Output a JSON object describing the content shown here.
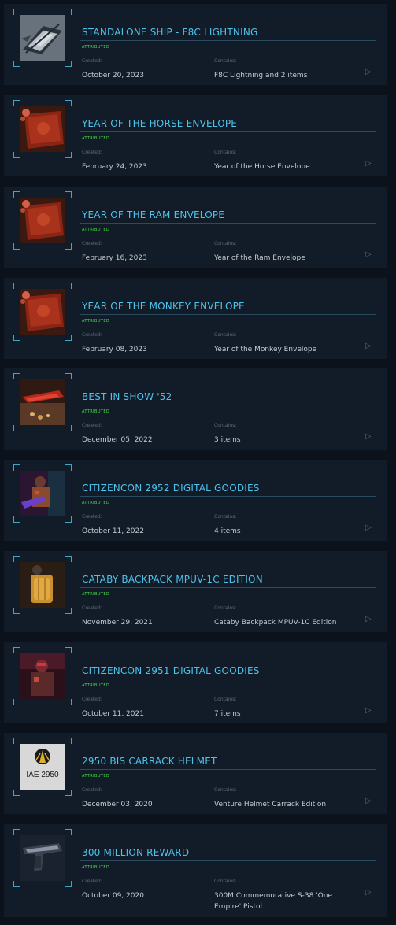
{
  "labels": {
    "created": "Created:",
    "contains": "Contains:"
  },
  "items": [
    {
      "title": "STANDALONE SHIP - F8C LIGHTNING",
      "status": "ATTRIBUTED",
      "created": "October 20, 2023",
      "contains": "F8C Lightning and 2 items",
      "thumbnail": "ship-image"
    },
    {
      "title": "YEAR OF THE HORSE ENVELOPE",
      "status": "ATTRIBUTED",
      "created": "February 24, 2023",
      "contains": "Year of the Horse Envelope",
      "thumbnail": "red-envelope-image"
    },
    {
      "title": "YEAR OF THE RAM ENVELOPE",
      "status": "ATTRIBUTED",
      "created": "February 16, 2023",
      "contains": "Year of the Ram Envelope",
      "thumbnail": "red-envelope-image"
    },
    {
      "title": "YEAR OF THE MONKEY ENVELOPE",
      "status": "ATTRIBUTED",
      "created": "February 08, 2023",
      "contains": "Year of the Monkey Envelope",
      "thumbnail": "red-envelope-image"
    },
    {
      "title": "BEST IN SHOW '52",
      "status": "ATTRIBUTED",
      "created": "December 05, 2022",
      "contains": "3 items",
      "thumbnail": "ship-on-table-image"
    },
    {
      "title": "CITIZENCON 2952 DIGITAL GOODIES",
      "status": "ATTRIBUTED",
      "created": "October 11, 2022",
      "contains": "4 items",
      "thumbnail": "armored-character-image"
    },
    {
      "title": "CATABY BACKPACK MPUV-1C EDITION",
      "status": "ATTRIBUTED",
      "created": "November 29, 2021",
      "contains": "Cataby Backpack MPUV-1C Edition",
      "thumbnail": "backpack-image"
    },
    {
      "title": "CITIZENCON 2951 DIGITAL GOODIES",
      "status": "ATTRIBUTED",
      "created": "October 11, 2021",
      "contains": "7 items",
      "thumbnail": "red-armor-character-image"
    },
    {
      "title": "2950 BIS CARRACK HELMET",
      "status": "ATTRIBUTED",
      "created": "December 03, 2020",
      "contains": "Venture Helmet Carrack Edition",
      "thumbnail": "iae-logo-image",
      "thumbnail_text": "IAE 2950"
    },
    {
      "title": "300 MILLION REWARD",
      "status": "ATTRIBUTED",
      "created": "October 09, 2020",
      "contains": "300M Commemorative S-38 'One Empire' Pistol",
      "thumbnail": "pistol-image"
    }
  ],
  "colors": {
    "background": "#0b121c",
    "card": "#111c28",
    "title": "#4fc2ea",
    "status": "#4be04b",
    "label": "#5a6c7a",
    "value": "#c4ccd4",
    "accent": "#3ea6c8",
    "arrow": "#4b6577"
  },
  "icons": {
    "row_arrow": "play-triangle-icon"
  }
}
